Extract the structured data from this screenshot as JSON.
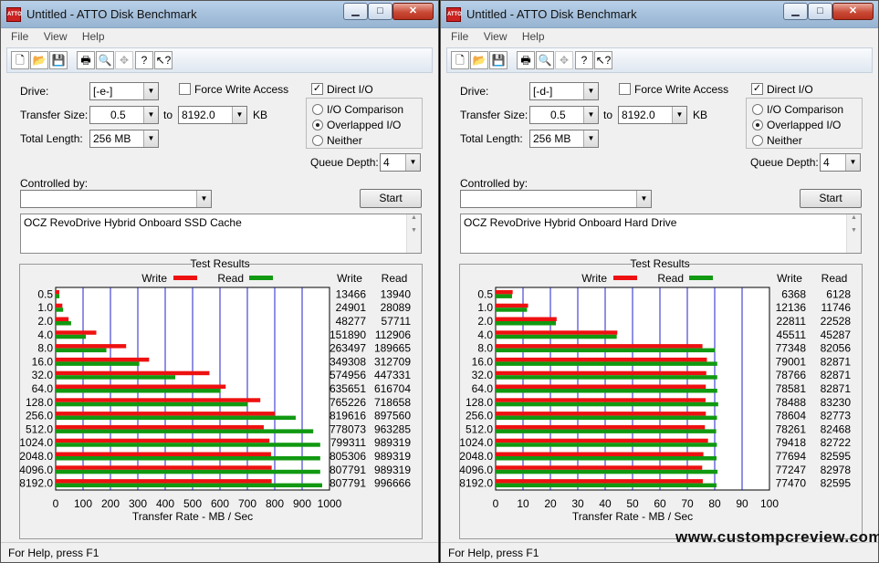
{
  "watermark": "www.custompcreview.com",
  "windows": [
    {
      "title": "Untitled - ATTO Disk Benchmark",
      "menu": [
        "File",
        "View",
        "Help"
      ],
      "drive_label": "Drive:",
      "drive": "[-e-]",
      "force_write": "Force Write Access",
      "force_write_checked": false,
      "direct_io": "Direct I/O",
      "direct_io_checked": true,
      "transfer_size_label": "Transfer Size:",
      "transfer_from": "0.5",
      "to_label": "to",
      "transfer_to": "8192.0",
      "kb_label": "KB",
      "total_length_label": "Total Length:",
      "total_length": "256 MB",
      "io_comparison": "I/O Comparison",
      "overlapped_io": "Overlapped I/O",
      "neither": "Neither",
      "io_mode": "overlapped",
      "queue_depth_label": "Queue Depth:",
      "queue_depth": "4",
      "controlled_by_label": "Controlled by:",
      "controlled_by": "",
      "start_label": "Start",
      "description": "OCZ RevoDrive Hybrid Onboard SSD Cache",
      "status": "For Help, press F1",
      "chart_data": {
        "type": "bar",
        "title": "Test Results",
        "xlabel": "Transfer Rate - MB / Sec",
        "xlim": [
          0,
          1000
        ],
        "xticks": [
          "0",
          "100",
          "200",
          "300",
          "400",
          "500",
          "600",
          "700",
          "800",
          "900",
          "1000"
        ],
        "legend": [
          "Write",
          "Read"
        ],
        "colors": {
          "write": "#ee1111",
          "read": "#119911"
        },
        "col_write": "Write",
        "col_read": "Read",
        "categories": [
          "0.5",
          "1.0",
          "2.0",
          "4.0",
          "8.0",
          "16.0",
          "32.0",
          "64.0",
          "128.0",
          "256.0",
          "512.0",
          "1024.0",
          "2048.0",
          "4096.0",
          "8192.0"
        ],
        "write": [
          13466,
          24901,
          48277,
          151890,
          263497,
          349308,
          574956,
          635651,
          765226,
          819616,
          778073,
          799311,
          805306,
          807791,
          807791
        ],
        "read": [
          13940,
          28089,
          57711,
          112906,
          189665,
          312709,
          447331,
          616704,
          718658,
          897560,
          963285,
          989319,
          989319,
          989319,
          996666
        ]
      }
    },
    {
      "title": "Untitled - ATTO Disk Benchmark",
      "menu": [
        "File",
        "View",
        "Help"
      ],
      "drive_label": "Drive:",
      "drive": "[-d-]",
      "force_write": "Force Write Access",
      "force_write_checked": false,
      "direct_io": "Direct I/O",
      "direct_io_checked": true,
      "transfer_size_label": "Transfer Size:",
      "transfer_from": "0.5",
      "to_label": "to",
      "transfer_to": "8192.0",
      "kb_label": "KB",
      "total_length_label": "Total Length:",
      "total_length": "256 MB",
      "io_comparison": "I/O Comparison",
      "overlapped_io": "Overlapped I/O",
      "neither": "Neither",
      "io_mode": "overlapped",
      "queue_depth_label": "Queue Depth:",
      "queue_depth": "4",
      "controlled_by_label": "Controlled by:",
      "controlled_by": "",
      "start_label": "Start",
      "description": "OCZ RevoDrive Hybrid Onboard Hard Drive",
      "status": "For Help, press F1",
      "chart_data": {
        "type": "bar",
        "title": "Test Results",
        "xlabel": "Transfer Rate - MB / Sec",
        "xlim": [
          0,
          100
        ],
        "xticks": [
          "0",
          "10",
          "20",
          "30",
          "40",
          "50",
          "60",
          "70",
          "80",
          "90",
          "100"
        ],
        "legend": [
          "Write",
          "Read"
        ],
        "colors": {
          "write": "#ee1111",
          "read": "#119911"
        },
        "col_write": "Write",
        "col_read": "Read",
        "categories": [
          "0.5",
          "1.0",
          "2.0",
          "4.0",
          "8.0",
          "16.0",
          "32.0",
          "64.0",
          "128.0",
          "256.0",
          "512.0",
          "1024.0",
          "2048.0",
          "4096.0",
          "8192.0"
        ],
        "write": [
          6368,
          12136,
          22811,
          45511,
          77348,
          79001,
          78766,
          78581,
          78488,
          78604,
          78261,
          79418,
          77694,
          77247,
          77470
        ],
        "read": [
          6128,
          11746,
          22528,
          45287,
          82056,
          82871,
          82871,
          82871,
          83230,
          82773,
          82468,
          82722,
          82595,
          82978,
          82595
        ]
      }
    }
  ]
}
